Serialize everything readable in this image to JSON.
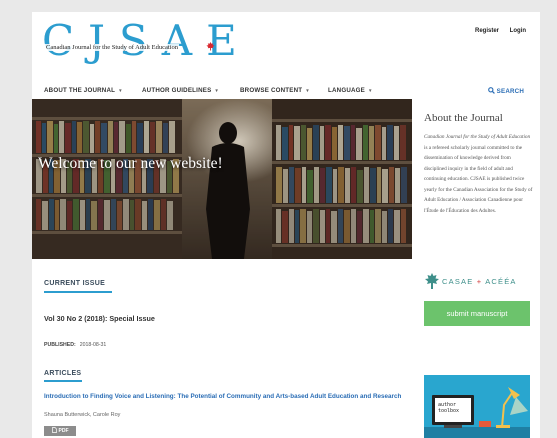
{
  "header": {
    "logo_letters": "CJSAE",
    "logo_subtitle": "Canadian Journal for the Study of Adult Education",
    "register_label": "Register",
    "login_label": "Login"
  },
  "nav": {
    "items": [
      {
        "label": "ABOUT THE JOURNAL"
      },
      {
        "label": "AUTHOR GUIDELINES"
      },
      {
        "label": "BROWSE CONTENT"
      },
      {
        "label": "LANGUAGE"
      }
    ],
    "search_label": "SEARCH"
  },
  "hero": {
    "title": "Welcome to our new website!"
  },
  "current_issue": {
    "heading": "CURRENT ISSUE",
    "issue_title": "Vol 30 No 2 (2018): Special Issue",
    "published_label": "PUBLISHED:",
    "published_date": "2018-08-31"
  },
  "articles": {
    "heading": "ARTICLES",
    "items": [
      {
        "title": "Introduction to Finding Voice and Listening: The Potential of Community and Arts-based Adult Education and Research",
        "authors": "Shauna Butterwick, Carole Roy",
        "pdf_label": "PDF"
      }
    ]
  },
  "sidebar": {
    "about_title": "About the Journal",
    "about_journal_name": "Canadian Journal for the Study of Adult Education",
    "about_text": " is a refereed scholarly journal committed to the dissemination of knowledge derived from disciplined inquiry in the field of adult and continuing education. CJSAE is published twice yearly for the Canadian Association for the Study of Adult Education / Association Canadienne pour l'Étude de l'Éducation des Adultes.",
    "casae_name": "CASAE",
    "casae_plus": "+",
    "acea_name": "ACÉÉA",
    "submit_label": "submit manuscript",
    "promo_text": "author toolbox"
  },
  "colors": {
    "accent_blue": "#2c9dcf",
    "link_blue": "#2a6db5",
    "submit_green": "#6cc36c",
    "leaf_red": "#d9282f"
  }
}
